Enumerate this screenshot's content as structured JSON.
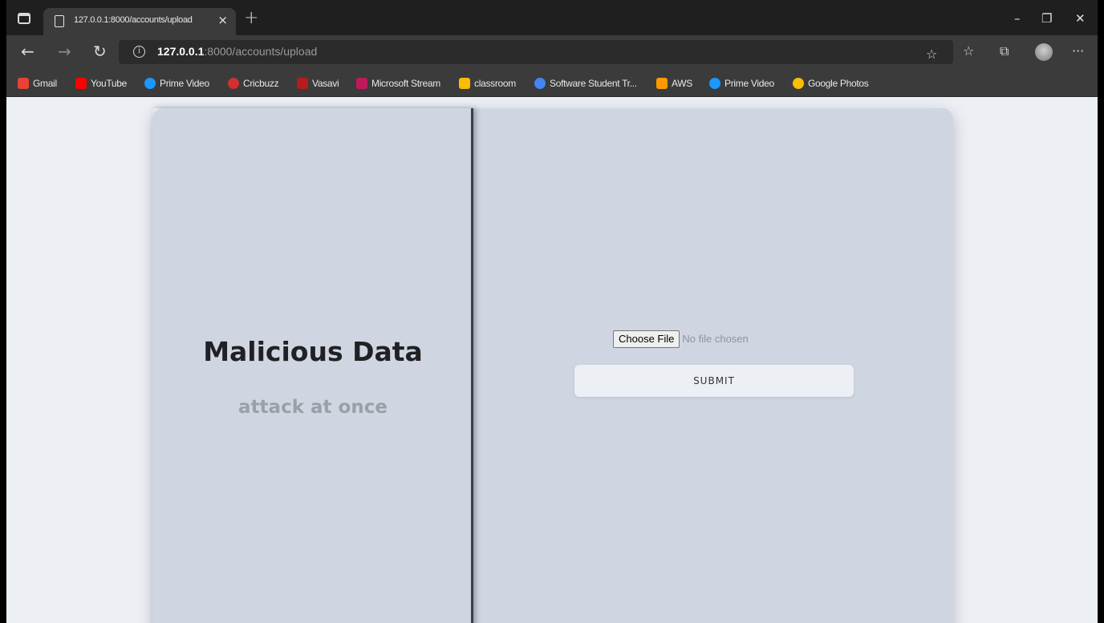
{
  "browser": {
    "tab_title": "127.0.0.1:8000/accounts/upload",
    "url_host": "127.0.0.1",
    "url_rest": ":8000/accounts/upload"
  },
  "bookmarks": [
    {
      "label": "Gmail",
      "color": "#ea4335"
    },
    {
      "label": "YouTube",
      "color": "#ff0000"
    },
    {
      "label": "Prime Video",
      "color": "#1a98ff"
    },
    {
      "label": "Cricbuzz",
      "color": "#d32f2f"
    },
    {
      "label": "Vasavi",
      "color": "#b71c1c"
    },
    {
      "label": "Microsoft Stream",
      "color": "#c2185b"
    },
    {
      "label": "classroom",
      "color": "#fbbc04"
    },
    {
      "label": "Software Student Tr...",
      "color": "#4285f4"
    },
    {
      "label": "AWS",
      "color": "#ff9900"
    },
    {
      "label": "Prime Video",
      "color": "#1a98ff"
    },
    {
      "label": "Google Photos",
      "color": "#fbbc04"
    }
  ],
  "panel": {
    "heading": "Malicious Data",
    "subheading": "attack at once"
  },
  "upload": {
    "choose_label": "Choose File",
    "no_file_text": "No file chosen",
    "submit_label": "SUBMIT"
  }
}
